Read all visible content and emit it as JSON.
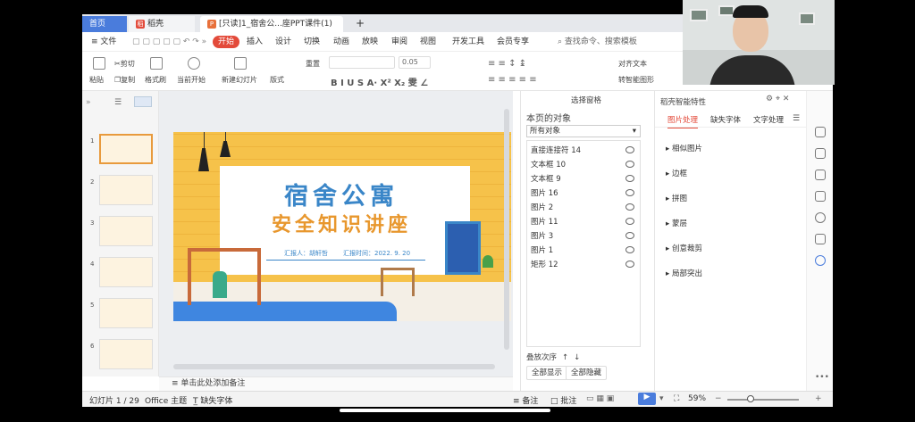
{
  "tabs": {
    "home": "首页",
    "docer": "稻壳",
    "doc_badge": "P",
    "doc": "[只读]1_宿舍公...座PPT课件(1)",
    "add": "+"
  },
  "menu": {
    "file": "≡ 文件",
    "items": [
      "开始",
      "插入",
      "设计",
      "切换",
      "动画",
      "放映",
      "审阅",
      "视图",
      "开发工具",
      "会员专享"
    ],
    "search": "查找命令、搜索模板"
  },
  "ribbon": {
    "paste": "粘贴",
    "cut": "剪切",
    "copy": "复制",
    "format_painter": "格式刷",
    "play_from_current": "当前开始",
    "new_slide": "新建幻灯片",
    "layout": "版式",
    "reset": "重置",
    "font_size": "0.05",
    "align": "对齐文本",
    "smart_shape": "转智能图形"
  },
  "thumbs": {
    "numbers": [
      "1",
      "2",
      "3",
      "4",
      "5",
      "6"
    ],
    "add": "+"
  },
  "slide": {
    "title1": "宿舍公寓",
    "title2": "安全知识讲座",
    "reporter": "汇报人：胡轩哲",
    "date": "汇报时间：2022. 9. 20"
  },
  "notes": {
    "text": "单击此处添加备注"
  },
  "selpane": {
    "title": "选择窗格",
    "section": "本页的对象",
    "filter": "所有对象",
    "objects": [
      "直接连接符 14",
      "文本框 10",
      "文本框 9",
      "图片 16",
      "图片 2",
      "图片 11",
      "图片 3",
      "图片 1",
      "矩形 12"
    ],
    "order_label": "叠放次序",
    "show_all": "全部显示",
    "hide_all": "全部隐藏"
  },
  "rpanel": {
    "title": "稻壳智能特性",
    "tabs": [
      "图片处理",
      "缺失字体",
      "文字处理"
    ],
    "items": [
      "相似图片",
      "边框",
      "拼图",
      "蒙层",
      "创意裁剪",
      "局部突出"
    ]
  },
  "status": {
    "slide_count": "幻灯片 1 / 29",
    "theme": "Office 主题",
    "missing_font": "缺失字体",
    "notes": "备注",
    "comment": "批注",
    "zoom": "59%"
  },
  "colors": {
    "accent": "#e34a3a",
    "blue": "#4a7cdc",
    "slide_bg": "#f6c24a",
    "title_blue": "#3a86c8",
    "title_orange": "#e8972d"
  }
}
